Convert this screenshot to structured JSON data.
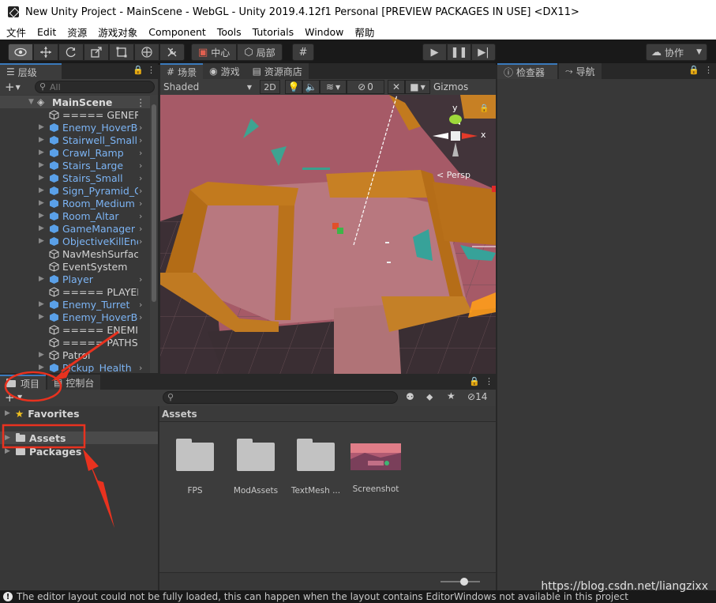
{
  "window": {
    "title": "New Unity Project - MainScene - WebGL - Unity 2019.4.12f1 Personal [PREVIEW PACKAGES IN USE] <DX11>"
  },
  "menu": [
    "文件",
    "Edit",
    "资源",
    "游戏对象",
    "Component",
    "Tools",
    "Tutorials",
    "Window",
    "帮助"
  ],
  "toolbar": {
    "pivot_center": "中心",
    "pivot_local": "局部",
    "collab": "协作"
  },
  "hierarchy": {
    "tab": "层级",
    "search_placeholder": "All",
    "scene_name": "MainScene",
    "items": [
      {
        "label": "===== GENERAL",
        "type": "plain",
        "expand": false,
        "chevron": false
      },
      {
        "label": "Enemy_HoverBot",
        "type": "prefab",
        "expand": true,
        "chevron": true
      },
      {
        "label": "Stairwell_Small",
        "type": "prefab",
        "expand": true,
        "chevron": true
      },
      {
        "label": "Crawl_Ramp",
        "type": "prefab",
        "expand": true,
        "chevron": true
      },
      {
        "label": "Stairs_Large",
        "type": "prefab",
        "expand": true,
        "chevron": true
      },
      {
        "label": "Stairs_Small",
        "type": "prefab",
        "expand": true,
        "chevron": true
      },
      {
        "label": "Sign_Pyramid_G",
        "type": "prefab",
        "expand": true,
        "chevron": true
      },
      {
        "label": "Room_Medium",
        "type": "prefab",
        "expand": true,
        "chevron": true
      },
      {
        "label": "Room_Altar",
        "type": "prefab",
        "expand": true,
        "chevron": true
      },
      {
        "label": "GameManager",
        "type": "prefab",
        "expand": true,
        "chevron": true
      },
      {
        "label": "ObjectiveKillEne",
        "type": "prefab",
        "expand": true,
        "chevron": true
      },
      {
        "label": "NavMeshSurface",
        "type": "plain",
        "expand": false,
        "chevron": false
      },
      {
        "label": "EventSystem",
        "type": "plain",
        "expand": false,
        "chevron": false
      },
      {
        "label": "Player",
        "type": "prefab",
        "expand": true,
        "chevron": true
      },
      {
        "label": "===== PLAYER ==",
        "type": "plain",
        "expand": false,
        "chevron": false
      },
      {
        "label": "Enemy_Turret",
        "type": "prefab",
        "expand": true,
        "chevron": true
      },
      {
        "label": "Enemy_HoverBc",
        "type": "prefab",
        "expand": true,
        "chevron": true
      },
      {
        "label": "===== ENEMIES",
        "type": "plain",
        "expand": false,
        "chevron": false
      },
      {
        "label": "===== PATHS ==",
        "type": "plain",
        "expand": false,
        "chevron": false
      },
      {
        "label": "Patrol",
        "type": "plain",
        "expand": true,
        "chevron": false
      },
      {
        "label": "Pickup_Health",
        "type": "prefab",
        "expand": true,
        "chevron": true
      }
    ]
  },
  "scene": {
    "tabs": [
      "场景",
      "游戏",
      "资源商店"
    ],
    "shading": "Shaded",
    "mode2d": "2D",
    "hidden_count": "0",
    "gizmos": "Gizmos",
    "persp": "Persp",
    "axis_x": "x",
    "axis_y": "y"
  },
  "inspector": {
    "tabs": [
      "检查器",
      "导航"
    ]
  },
  "project": {
    "tabs": [
      "项目",
      "控制台"
    ],
    "tree": [
      "Favorites",
      "Assets",
      "Packages"
    ],
    "breadcrumb": "Assets",
    "hidden_count": "14",
    "assets": [
      {
        "name": "FPS",
        "kind": "folder"
      },
      {
        "name": "ModAssets",
        "kind": "folder"
      },
      {
        "name": "TextMesh ...",
        "kind": "folder"
      },
      {
        "name": "Screenshot",
        "kind": "image"
      }
    ]
  },
  "status": {
    "message": "The editor layout could not be fully loaded, this can happen when the layout contains EditorWindows not available in this project"
  },
  "watermark": "https://blog.csdn.net/liangzixx",
  "colors": {
    "prefab_text": "#7cb4f4",
    "annotation": "#e8321f",
    "tab_accent": "#3a79bb"
  }
}
